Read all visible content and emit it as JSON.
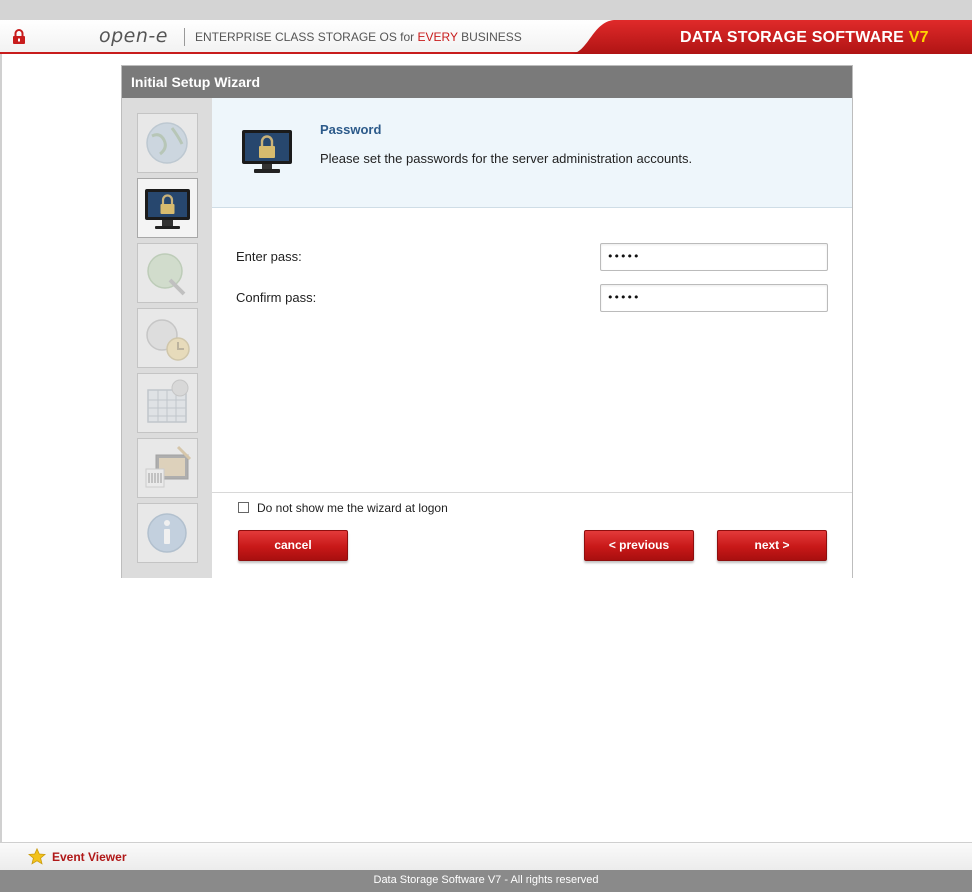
{
  "header": {
    "logo": "open-e",
    "tagline_prefix": "ENTERPRISE CLASS STORAGE OS for ",
    "tagline_highlight": "EVERY",
    "tagline_suffix": " BUSINESS",
    "product_title": "DATA STORAGE SOFTWARE ",
    "product_version": "V7"
  },
  "wizard": {
    "title": "Initial Setup Wizard",
    "steps": [
      {
        "icon": "globe-icon",
        "state": "done"
      },
      {
        "icon": "monitor-lock-icon",
        "state": "active"
      },
      {
        "icon": "network-globe-icon",
        "state": "pending"
      },
      {
        "icon": "clock-icon",
        "state": "pending"
      },
      {
        "icon": "calendar-icon",
        "state": "pending"
      },
      {
        "icon": "license-icon",
        "state": "pending"
      },
      {
        "icon": "info-icon",
        "state": "pending"
      }
    ],
    "section_title": "Password",
    "section_description": "Please set the passwords for the server administration accounts.",
    "fields": {
      "enter_label": "Enter pass:",
      "enter_value": "•••••",
      "confirm_label": "Confirm pass:",
      "confirm_value": "•••••"
    },
    "checkbox_label": "Do not show me the wizard at logon",
    "checkbox_checked": false,
    "buttons": {
      "cancel": "cancel",
      "previous": "< previous",
      "next": "next >"
    }
  },
  "colors": {
    "accent_red": "#c81c1c",
    "title_blue": "#2c5a8a",
    "version_yellow": "#ffd400"
  },
  "event_viewer": {
    "label": "Event Viewer"
  },
  "status_bar": {
    "text": "Data Storage Software V7 - All rights reserved"
  }
}
